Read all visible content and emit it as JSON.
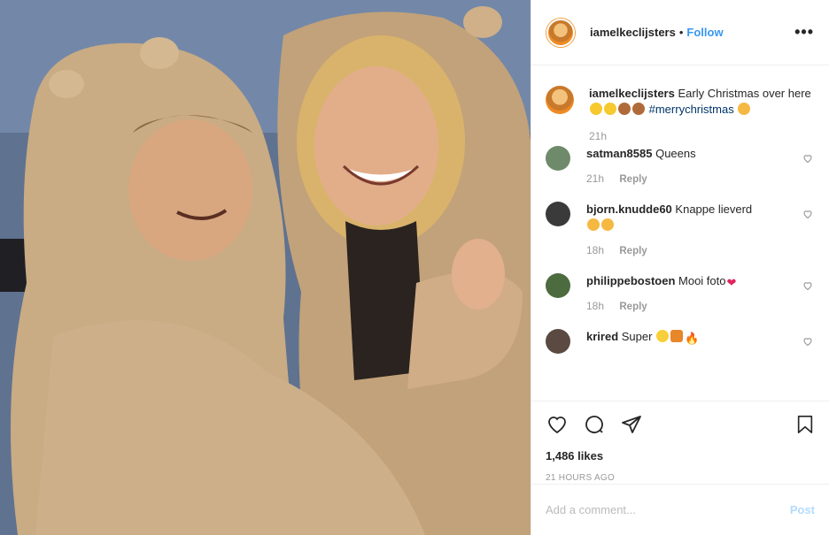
{
  "post": {
    "username": "iamelkeclijsters",
    "follow_label": "Follow",
    "more_label": "•••"
  },
  "caption": {
    "username": "iamelkeclijsters",
    "text_a": "Early Christmas over here",
    "hashtag": "#merrychristmas",
    "age": "21h"
  },
  "comments": [
    {
      "username": "satman8585",
      "text": "Queens",
      "age": "21h",
      "reply": "Reply"
    },
    {
      "username": "bjorn.knudde60",
      "text": "Knappe lieverd",
      "age": "18h",
      "reply": "Reply"
    },
    {
      "username": "philippebostoen",
      "text": "Mooi foto",
      "age": "18h",
      "reply": "Reply"
    },
    {
      "username": "krired",
      "text": "Super",
      "age": "",
      "reply": ""
    }
  ],
  "stats": {
    "likes": "1,486 likes",
    "timestamp": "21 HOURS AGO"
  },
  "composer": {
    "placeholder": "Add a comment...",
    "post_label": "Post"
  },
  "colors": {
    "link_blue": "#3897f0",
    "post_disabled": "#b3dbff",
    "heart_red": "#e0245e"
  }
}
